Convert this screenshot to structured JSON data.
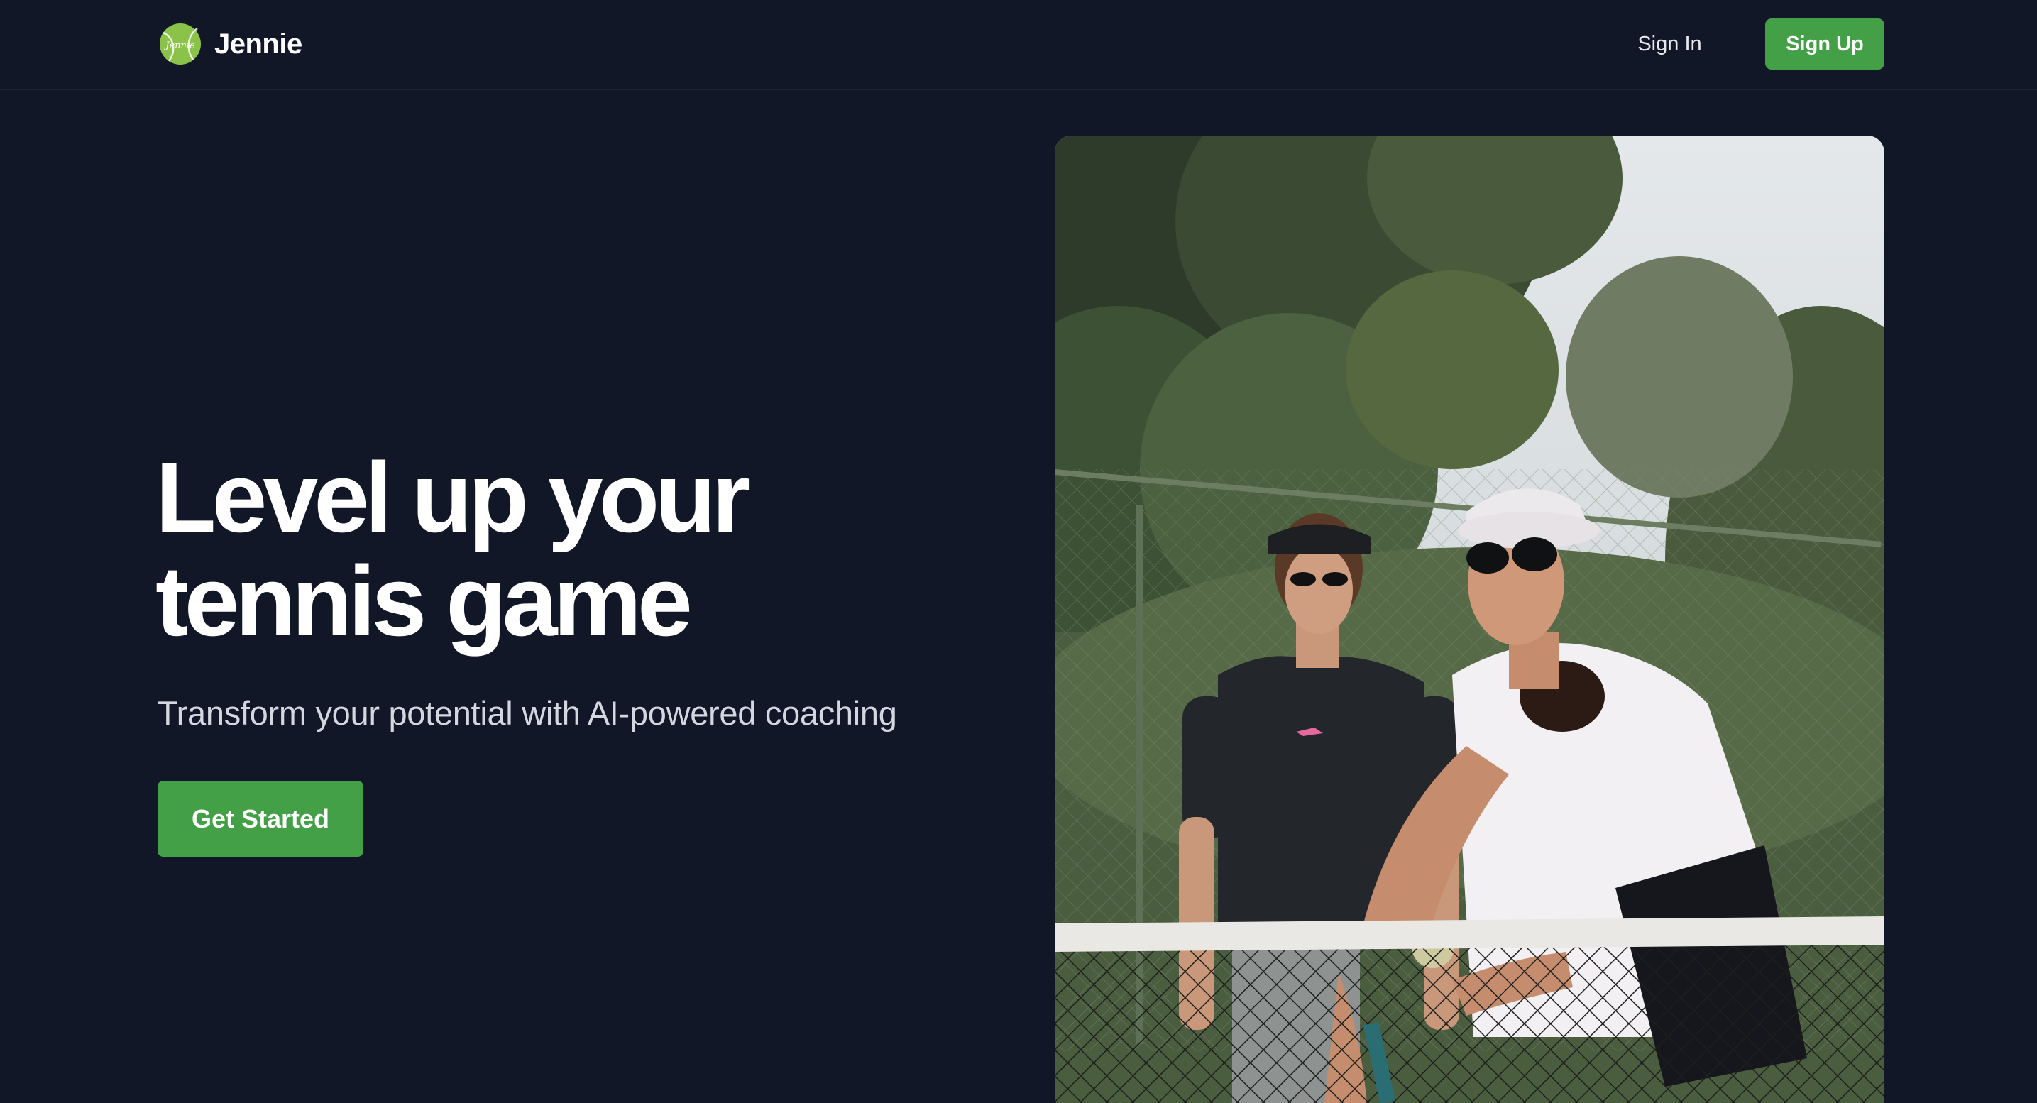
{
  "header": {
    "brand": {
      "name": "Jennie",
      "logo_icon": "tennis-ball-logo-icon",
      "logo_text": "Jennie"
    },
    "nav": {
      "sign_in": "Sign In",
      "sign_up": "Sign Up"
    }
  },
  "hero": {
    "title_line_1": "Level up your",
    "title_line_2": "tennis game",
    "subtitle": "Transform your potential with AI-powered coaching",
    "cta_label": "Get Started",
    "image": {
      "subject": "two-women-tennis-players-at-net-photo"
    }
  },
  "colors": {
    "background": "#121728",
    "accent": "#43a047",
    "text_primary": "#ffffff",
    "text_secondary": "#d3d7df",
    "logo_ball": "#8bc34a"
  }
}
